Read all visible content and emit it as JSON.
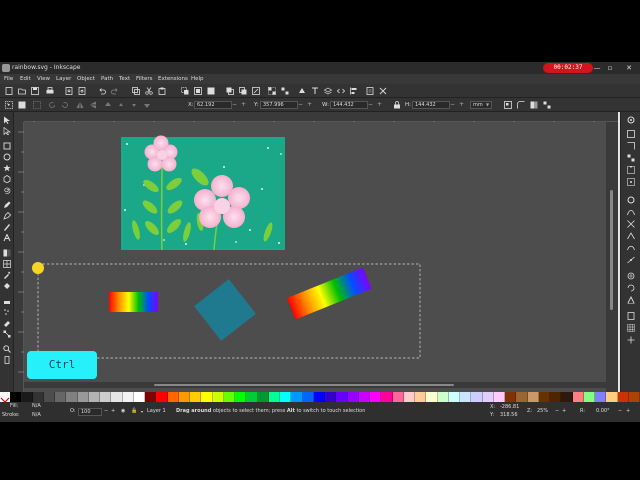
{
  "window": {
    "title": "rainbow.svg - Inkscape",
    "timer": "00:02:37"
  },
  "menubar": [
    "File",
    "Edit",
    "View",
    "Layer",
    "Object",
    "Path",
    "Text",
    "Filters",
    "Extensions",
    "Help"
  ],
  "toolcontrols": {
    "x_label": "X:",
    "x_value": "62.192",
    "y_label": "Y:",
    "y_value": "357.996",
    "w_label": "W:",
    "w_value": "144.432",
    "h_label": "H:",
    "h_value": "144.432",
    "unit": "mm"
  },
  "canvas_objects": {
    "image_bg_color": "#1aa888",
    "petal_color": "#f4a6c8",
    "leaf_color": "#7ccf3b",
    "square_color": "#1f7a90"
  },
  "rainbow_colors": [
    "#ff0000",
    "#ff8c00",
    "#ffff00",
    "#00c000",
    "#0050ff",
    "#8000ff"
  ],
  "palette_colors": [
    "#000000",
    "#1a1a1a",
    "#333333",
    "#4d4d4d",
    "#666666",
    "#808080",
    "#999999",
    "#b3b3b3",
    "#cccccc",
    "#e6e6e6",
    "#f2f2f2",
    "#ffffff",
    "#800000",
    "#ff0000",
    "#ff6600",
    "#ff9900",
    "#ffcc00",
    "#ffff00",
    "#ccff00",
    "#66ff00",
    "#00ff00",
    "#00cc33",
    "#009933",
    "#00ff99",
    "#00ffff",
    "#0099ff",
    "#0066ff",
    "#0000ff",
    "#3300cc",
    "#6600ff",
    "#9900ff",
    "#cc00ff",
    "#ff00ff",
    "#ff0099",
    "#ff6699",
    "#ffcccc",
    "#ffcc99",
    "#ffffcc",
    "#ccffcc",
    "#ccffff",
    "#cce5ff",
    "#ccccff",
    "#e5ccff",
    "#ffccff",
    "#803300",
    "#996633",
    "#cc9966",
    "#663300",
    "#4d2600",
    "#2b1a0d",
    "#ff8080",
    "#80ff80",
    "#8080ff",
    "#ffcc80",
    "#cc3300",
    "#aa4400"
  ],
  "status": {
    "fill_label": "Fill:",
    "fill_value": "N/A",
    "stroke_label": "Stroke:",
    "stroke_value": "N/A",
    "opacity_label": "O:",
    "opacity_value": "100",
    "layer": "Layer 1",
    "message_bold1": "Drag around",
    "message_1": " objects to select them; press ",
    "message_bold2": "Alt",
    "message_2": " to switch to touch selection",
    "x_label": "X:",
    "x_coord": "-286.81",
    "y_label": "Y:",
    "y_coord": "318.56",
    "zoom_label": "Z:",
    "zoom": "25%",
    "rotate_label": "R:",
    "rotation": "0.00°"
  },
  "key_badge": "Ctrl"
}
